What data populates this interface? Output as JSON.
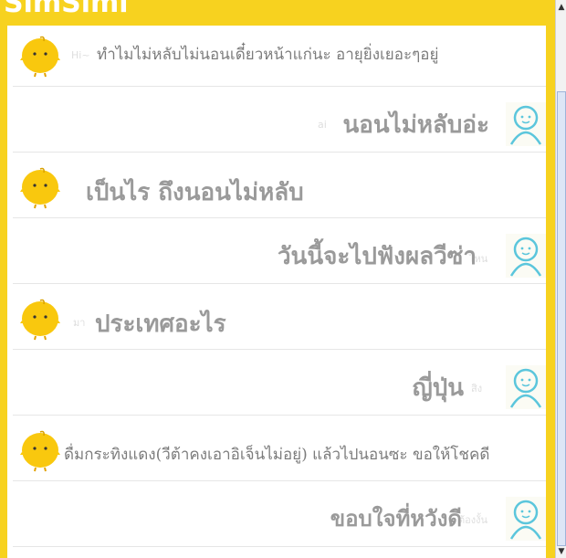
{
  "app": {
    "brand": "SimSimi"
  },
  "messages": [
    {
      "from": "simsimi",
      "ghost": "Hi~",
      "text": "ทำไมไม่หลับไม่นอนเดี๋ยวหน้าแก่นะ อายุยิ่งเยอะๆอยู่"
    },
    {
      "from": "user",
      "ghost": "ai",
      "text": "นอนไม่หลับอ่ะ"
    },
    {
      "from": "simsimi",
      "ghost": "",
      "text": "เป็นไร ถึงนอนไม่หลับ"
    },
    {
      "from": "user",
      "ghost": "ไหน",
      "text": "วันนี้จะไปฟังผลวีซ่า"
    },
    {
      "from": "simsimi",
      "ghost": "มา",
      "text": "ประเทศอะไร"
    },
    {
      "from": "user",
      "ghost": "สิง",
      "text": "ญี่ปุ่น"
    },
    {
      "from": "simsimi",
      "ghost": "",
      "text": "ดื่มกระทิงแดง(วีต้าคงเอาอิเจ็นไม่อยู่) แล้วไปนอนซะ ขอให้โชคดี"
    },
    {
      "from": "user",
      "ghost": "ต้องงั้น",
      "text": "ขอบใจที่หวังดี"
    }
  ],
  "colors": {
    "frame": "#f7d21f",
    "simsimi_avatar": "#f9c80e",
    "user_avatar": "#5bc6dc"
  },
  "icons": {
    "simsimi_avatar": "simsimi-chick-icon",
    "user_avatar": "user-outline-icon",
    "scroll_up": "arrow-up-icon",
    "scroll_down": "arrow-down-icon"
  },
  "scrollbar": {
    "up_glyph": "▲",
    "down_glyph": "▼"
  }
}
